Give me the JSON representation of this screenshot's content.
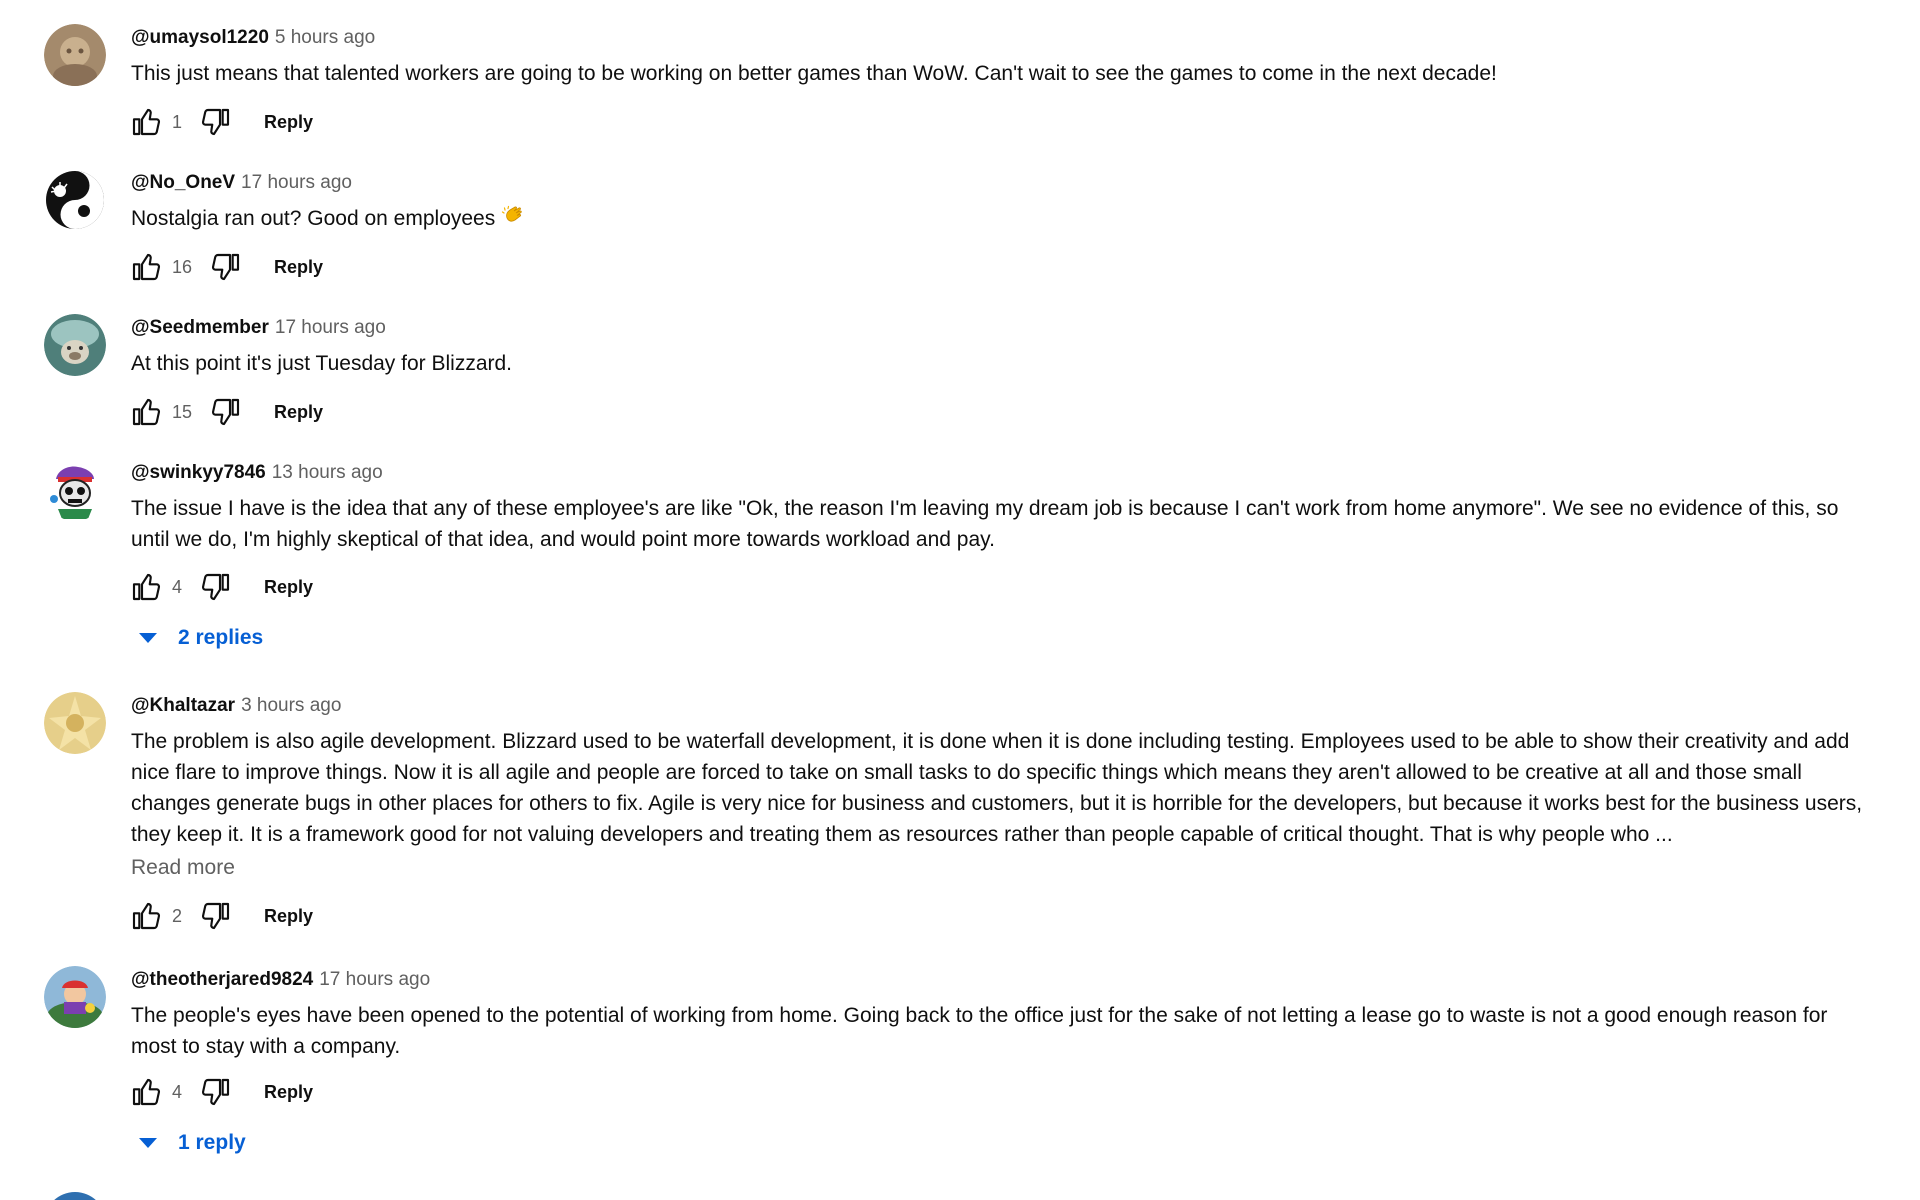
{
  "comments": [
    {
      "author": "@umaysol1220",
      "time": "5 hours ago",
      "text": "This just means that talented workers are going to be working on better games than WoW. Can't wait to see the games to come in the next decade!",
      "likes": "1",
      "reply_label": "Reply"
    },
    {
      "author": "@No_OneV",
      "time": "17 hours ago",
      "text": "Nostalgia ran out? Good on employees",
      "emoji": "clapping-hand-emoji",
      "likes": "16",
      "reply_label": "Reply"
    },
    {
      "author": "@Seedmember",
      "time": "17 hours ago",
      "text": "At this point it's just Tuesday for Blizzard.",
      "likes": "15",
      "reply_label": "Reply"
    },
    {
      "author": "@swinkyy7846",
      "time": "13 hours ago",
      "text": "The issue I have is the idea that any of these employee's are like \"Ok, the reason I'm leaving my dream job is because I can't work from home anymore\". We see no evidence of this, so until we do, I'm highly skeptical of that idea, and would point more towards workload and pay.",
      "likes": "4",
      "reply_label": "Reply",
      "replies_label": "2 replies"
    },
    {
      "author": "@Khaltazar",
      "time": "3 hours ago",
      "text": "The problem is also agile development. Blizzard used to be waterfall development, it is done when it is done including testing. Employees used to be able to show their creativity and add nice flare to improve things. Now it is all agile and people are forced to take on small tasks to do specific things which means they aren't allowed to be creative at all and those small changes generate bugs in other places for others to fix. Agile is very nice for business and customers, but it is horrible for the developers, but because it works best for the business users, they keep it. It is a framework good for not valuing developers and treating them as resources rather than people capable of critical thought. That is why people who ...",
      "read_more": "Read more",
      "likes": "2",
      "reply_label": "Reply"
    },
    {
      "author": "@theotherjared9824",
      "time": "17 hours ago",
      "text": "The people's eyes have been opened to the potential of working from home. Going back to the office just for the sake of not letting a lease go to waste is not a good enough reason for most to stay with a company.",
      "likes": "4",
      "reply_label": "Reply",
      "replies_label": "1 reply"
    }
  ],
  "colors": {
    "link_blue": "#065fd4",
    "meta_gray": "#606060",
    "text": "#0f0f0f"
  },
  "icons": {
    "like": "thumbs-up-icon",
    "dislike": "thumbs-down-icon",
    "expand": "caret-down-icon"
  }
}
